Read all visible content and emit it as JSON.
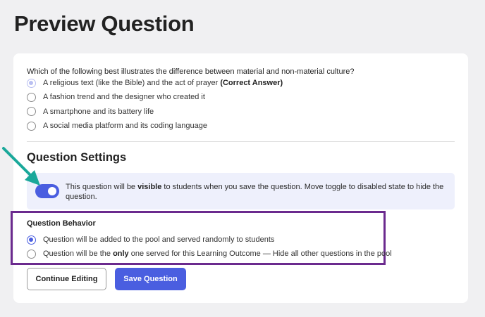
{
  "page": {
    "title": "Preview Question"
  },
  "question": {
    "text": "Which of the following best illustrates the difference between material and non-material culture?",
    "options": [
      {
        "label": "A religious text (like the Bible) and the act of prayer",
        "suffix": "(Correct Answer)",
        "selected": true
      },
      {
        "label": "A fashion trend and the designer who created it",
        "suffix": "",
        "selected": false
      },
      {
        "label": "A smartphone and its battery life",
        "suffix": "",
        "selected": false
      },
      {
        "label": "A social media platform and its coding language",
        "suffix": "",
        "selected": false
      }
    ]
  },
  "settings": {
    "title": "Question Settings",
    "visibility": {
      "enabled": true,
      "text_before": "This question will be ",
      "text_bold": "visible",
      "text_after": " to students when you save the question. Move toggle to disabled state to hide the question."
    },
    "behavior": {
      "title": "Question Behavior",
      "option_pool": "Question will be added to the pool and served randomly to students",
      "option_only_before": "Question will be the ",
      "option_only_bold": "only",
      "option_only_after": " one served for this Learning Outcome — Hide all other questions in the pool",
      "selected": "pool"
    }
  },
  "actions": {
    "continue_label": "Continue Editing",
    "save_label": "Save Question"
  },
  "colors": {
    "accent": "#4a5ee0",
    "highlight_box": "#6b2a8e",
    "annotation_arrow": "#1aa89a",
    "visibility_bg": "#eef0fc"
  }
}
